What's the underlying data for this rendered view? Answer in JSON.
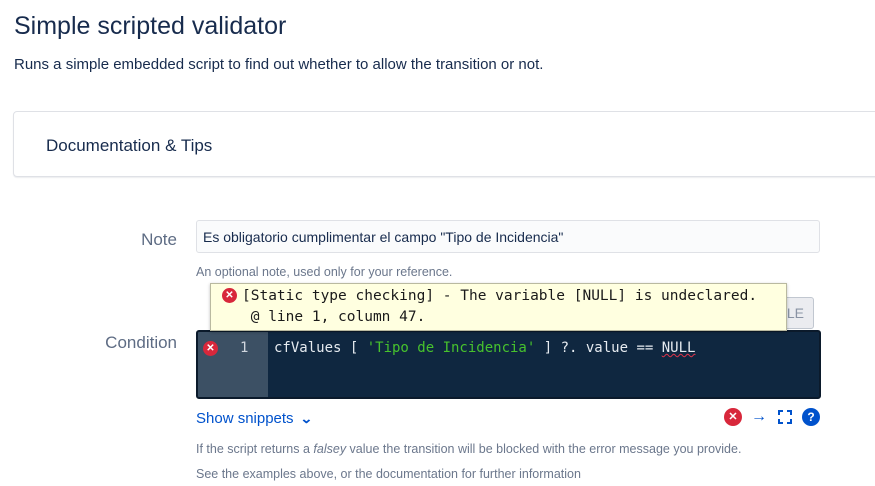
{
  "header": {
    "title": "Simple scripted validator",
    "description": "Runs a simple embedded script to find out whether to allow the transition or not."
  },
  "doc_panel": {
    "title": "Documentation & Tips"
  },
  "note": {
    "label": "Note",
    "value": "Es obligatorio cumplimentar el campo \"Tipo de Incidencia\"",
    "help": "An optional note, used only for your reference."
  },
  "condition": {
    "label": "Condition",
    "line_number": "1",
    "code_prefix": "cfValues [ ",
    "code_string": "'Tipo de Incidencia'",
    "code_middle": " ] ?. value == ",
    "code_error_token": "NULL",
    "hidden_button_text": "LE"
  },
  "tooltip": {
    "line1": "[Static type checking] - The variable [NULL] is undeclared.",
    "line2": " @ line 1, column 47."
  },
  "snippets": {
    "label": "Show snippets",
    "chevron": "»"
  },
  "toolbar": {
    "error_icon": "error-icon",
    "arrow_icon": "arrow-right-icon",
    "fullscreen_icon": "fullscreen-icon",
    "help_icon": "help-icon"
  },
  "help_text": {
    "line1_prefix": "If the script returns a ",
    "line1_emph": "falsey",
    "line1_suffix": " value the transition will be blocked with the error message you provide.",
    "line2": "See the examples above, or the documentation for further information"
  },
  "colors": {
    "accent": "#0052cc",
    "error": "#d8273b",
    "editor_bg": "#0f2740",
    "string": "#47c22d"
  }
}
